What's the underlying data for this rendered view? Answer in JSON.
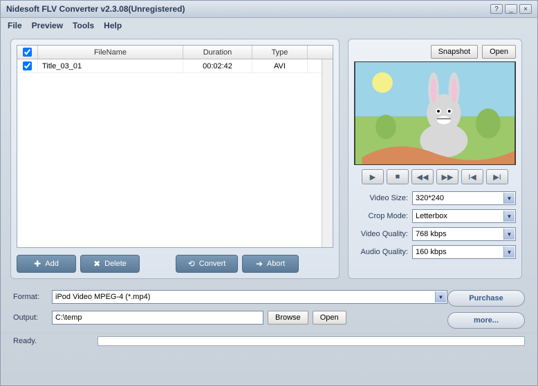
{
  "window": {
    "title": "Nidesoft FLV Converter v2.3.08(Unregistered)",
    "help_btn": "?",
    "min_btn": "_",
    "close_btn": "×"
  },
  "menu": {
    "file": "File",
    "preview": "Preview",
    "tools": "Tools",
    "help": "Help"
  },
  "table": {
    "headers": {
      "filename": "FileName",
      "duration": "Duration",
      "type": "Type"
    },
    "rows": [
      {
        "checked": true,
        "name": "Title_03_01",
        "duration": "00:02:42",
        "type": "AVI"
      }
    ]
  },
  "actions": {
    "add": "Add",
    "delete": "Delete",
    "convert": "Convert",
    "abort": "Abort"
  },
  "preview_controls": {
    "snapshot": "Snapshot",
    "open": "Open"
  },
  "settings": {
    "video_size": {
      "label": "Video Size:",
      "value": "320*240"
    },
    "crop_mode": {
      "label": "Crop Mode:",
      "value": "Letterbox"
    },
    "video_quality": {
      "label": "Video Quality:",
      "value": "768 kbps"
    },
    "audio_quality": {
      "label": "Audio Quality:",
      "value": "160 kbps"
    }
  },
  "format": {
    "label": "Format:",
    "value": "iPod Video MPEG-4 (*.mp4)"
  },
  "output": {
    "label": "Output:",
    "value": "C:\\temp",
    "browse": "Browse",
    "open": "Open"
  },
  "side": {
    "purchase": "Purchase",
    "more": "more..."
  },
  "status": {
    "text": "Ready."
  }
}
